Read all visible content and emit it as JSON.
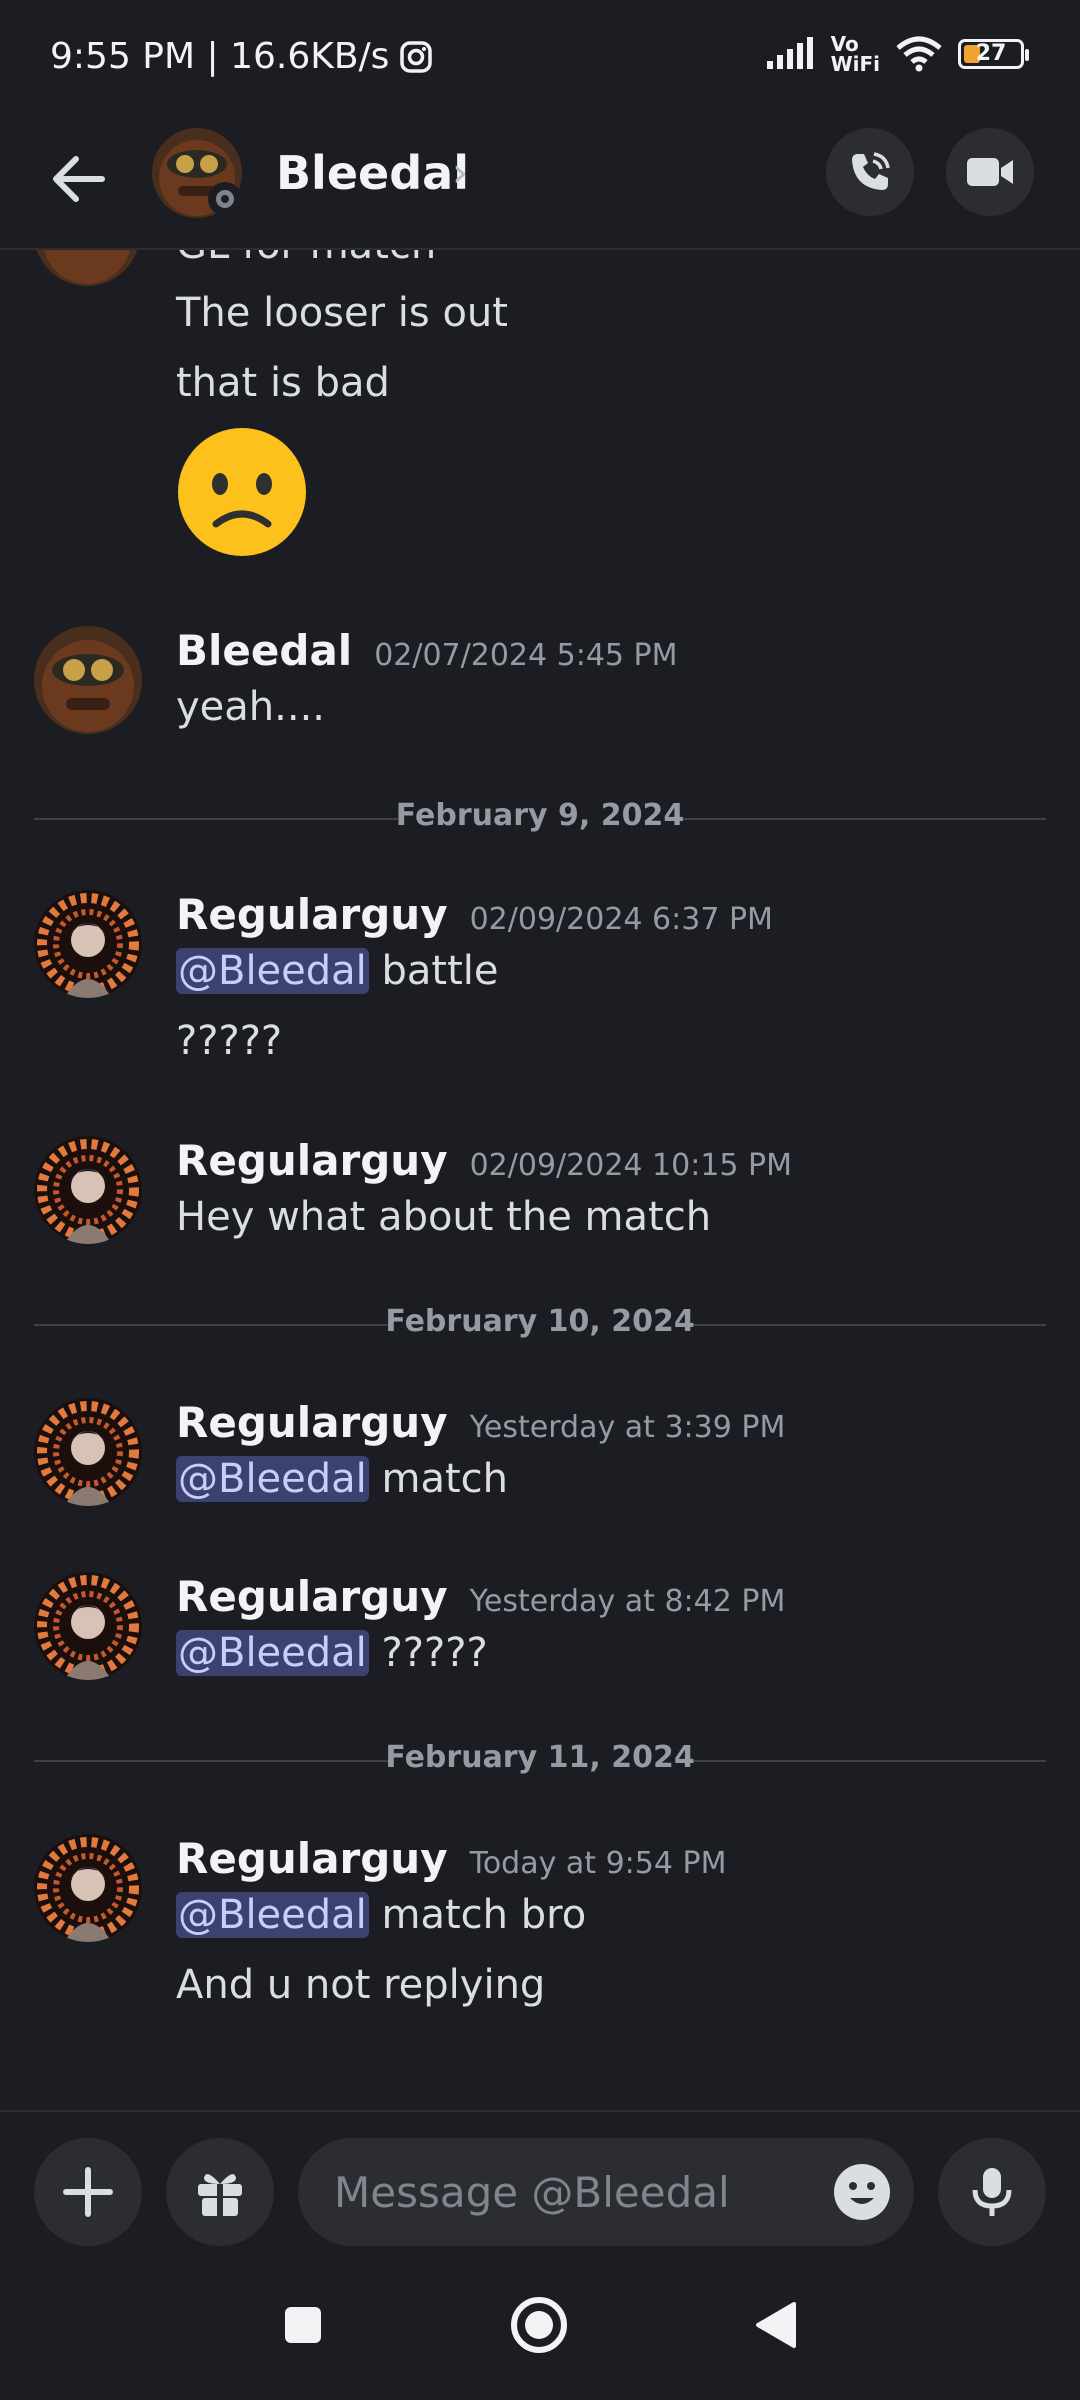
{
  "status_bar": {
    "time_speed": "9:55 PM | 16.6KB/s",
    "network_label_top": "Vo",
    "network_label_bottom": "WiFi",
    "battery": "27"
  },
  "header": {
    "title": "Bleedal"
  },
  "chat": {
    "partial_messages": [
      "GL for match",
      "The looser is out",
      "that is bad"
    ],
    "messages": [
      {
        "author": "Bleedal",
        "timestamp": "02/07/2024 5:45 PM",
        "lines": [
          "yeah...."
        ]
      },
      {
        "author": "Regularguy",
        "timestamp": "02/09/2024 6:37 PM",
        "mention": "@Bleedal",
        "line1": "battle",
        "line2": "?????"
      },
      {
        "author": "Regularguy",
        "timestamp": "02/09/2024 10:15 PM",
        "line1": "Hey what about the match"
      },
      {
        "author": "Regularguy",
        "timestamp": "Yesterday at 3:39 PM",
        "mention": "@Bleedal",
        "line1": "match"
      },
      {
        "author": "Regularguy",
        "timestamp": "Yesterday at 8:42 PM",
        "mention": "@Bleedal",
        "line1": "?????"
      },
      {
        "author": "Regularguy",
        "timestamp": "Today at 9:54 PM",
        "mention": "@Bleedal",
        "line1": "match bro",
        "line2": "And u not replying"
      }
    ],
    "dividers": [
      "February 9, 2024",
      "February 10, 2024",
      "February 11, 2024"
    ]
  },
  "composer": {
    "placeholder": "Message @Bleedal"
  },
  "colors": {
    "background": "#1c1d22",
    "mention_bg": "#3c4270",
    "mention_text": "#c9cdfb",
    "battery_fill": "#f0a32f"
  },
  "icons": [
    "back-arrow-icon",
    "phone-call-icon",
    "video-camera-icon",
    "plus-icon",
    "gift-icon",
    "emoji-icon",
    "microphone-icon",
    "recent-apps-icon",
    "home-icon",
    "back-triangle-icon",
    "instagram-icon",
    "signal-icon",
    "wifi-icon",
    "battery-icon"
  ]
}
